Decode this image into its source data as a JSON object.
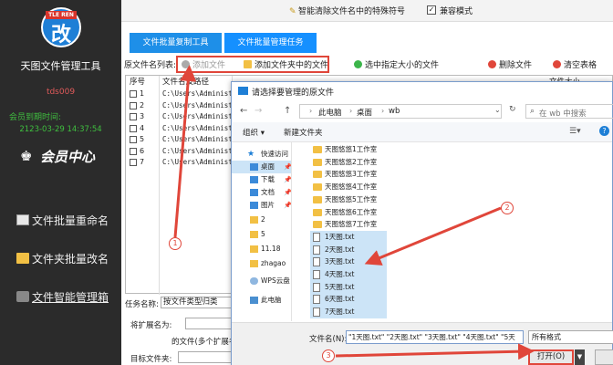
{
  "sidebar": {
    "logo_ribbon": "TLE REN",
    "logo_char": "改",
    "app_title": "天图文件管理工具",
    "user_id": "tds009",
    "member_expiry_label": "会员到期时间:",
    "member_expiry_date": "2123-03-29 14:37:54",
    "member_center": "会员中心",
    "nav": [
      {
        "label": "文件批量重命名"
      },
      {
        "label": "文件夹批量改名"
      },
      {
        "label": "文件智能管理箱"
      }
    ]
  },
  "topbar": {
    "smart_clean": "智能清除文件名中的特殊符号",
    "compat_label": "兼容模式",
    "compat_checked": "✓"
  },
  "tabs": [
    {
      "label": "文件批量复制工具"
    },
    {
      "label": "文件批量管理任务"
    }
  ],
  "toolbar": {
    "list_label": "原文件名列表:",
    "add_file": "添加文件",
    "add_folder": "添加文件夹中的文件",
    "select_size": "选中指定大小的文件",
    "delete": "删除文件",
    "clear": "清空表格"
  },
  "file_table": {
    "col_num": "序号",
    "col_path": "文件名及路径",
    "col_size": "文件大小",
    "rows": [
      {
        "no": "1",
        "path": "C:\\Users\\Administra"
      },
      {
        "no": "2",
        "path": "C:\\Users\\Administra"
      },
      {
        "no": "3",
        "path": "C:\\Users\\Administra"
      },
      {
        "no": "4",
        "path": "C:\\Users\\Administra"
      },
      {
        "no": "5",
        "path": "C:\\Users\\Administra"
      },
      {
        "no": "6",
        "path": "C:\\Users\\Administra"
      },
      {
        "no": "7",
        "path": "C:\\Users\\Administra"
      }
    ]
  },
  "form": {
    "task_name_label": "任务名称:",
    "task_name_value": "按文件类型归类",
    "ext_label": "将扩展名为:",
    "ext_hint": "的文件(多个扩展名",
    "target_label": "目标文件夹:"
  },
  "dialog": {
    "title": "请选择要管理的原文件",
    "breadcrumb": [
      "此电脑",
      "桌面",
      "wb"
    ],
    "search_placeholder": "在 wb 中搜索",
    "organize": "组织 ▾",
    "new_folder": "新建文件夹",
    "help": "?",
    "left_nav": [
      {
        "label": "快速访问",
        "pin": ""
      },
      {
        "label": "桌面",
        "pin": "📌"
      },
      {
        "label": "下载",
        "pin": "📌"
      },
      {
        "label": "文档",
        "pin": "📌"
      },
      {
        "label": "图片",
        "pin": "📌"
      },
      {
        "label": "2",
        "pin": ""
      },
      {
        "label": "5",
        "pin": ""
      },
      {
        "label": "11.18",
        "pin": ""
      },
      {
        "label": "zhagao",
        "pin": ""
      },
      {
        "label": "WPS云盘",
        "pin": ""
      },
      {
        "label": "此电脑",
        "pin": ""
      }
    ],
    "files": [
      {
        "name": "天图悠悠1工作室",
        "kind": "folder"
      },
      {
        "name": "天图悠悠2工作室",
        "kind": "folder"
      },
      {
        "name": "天图悠悠3工作室",
        "kind": "folder"
      },
      {
        "name": "天图悠悠4工作室",
        "kind": "folder"
      },
      {
        "name": "天图悠悠5工作室",
        "kind": "folder"
      },
      {
        "name": "天图悠悠6工作室",
        "kind": "folder"
      },
      {
        "name": "天图悠悠7工作室",
        "kind": "folder"
      },
      {
        "name": "1天图.txt",
        "kind": "txt"
      },
      {
        "name": "2天图.txt",
        "kind": "txt"
      },
      {
        "name": "3天图.txt",
        "kind": "txt"
      },
      {
        "name": "4天图.txt",
        "kind": "txt"
      },
      {
        "name": "5天图.txt",
        "kind": "txt"
      },
      {
        "name": "6天图.txt",
        "kind": "txt"
      },
      {
        "name": "7天图.txt",
        "kind": "txt"
      }
    ],
    "filename_label": "文件名(N):",
    "filename_value": "\"1天图.txt\" \"2天图.txt\" \"3天图.txt\" \"4天图.txt\" \"5天",
    "filetype": "所有格式",
    "open": "打开(O)"
  },
  "annotations": [
    "1",
    "2",
    "3"
  ],
  "colors": {
    "sidebar_bg": "#2b2b2b",
    "tab_blue": "#1e8fe8",
    "annotation_red": "#e0463a",
    "selection_blue": "#cce4f7"
  }
}
